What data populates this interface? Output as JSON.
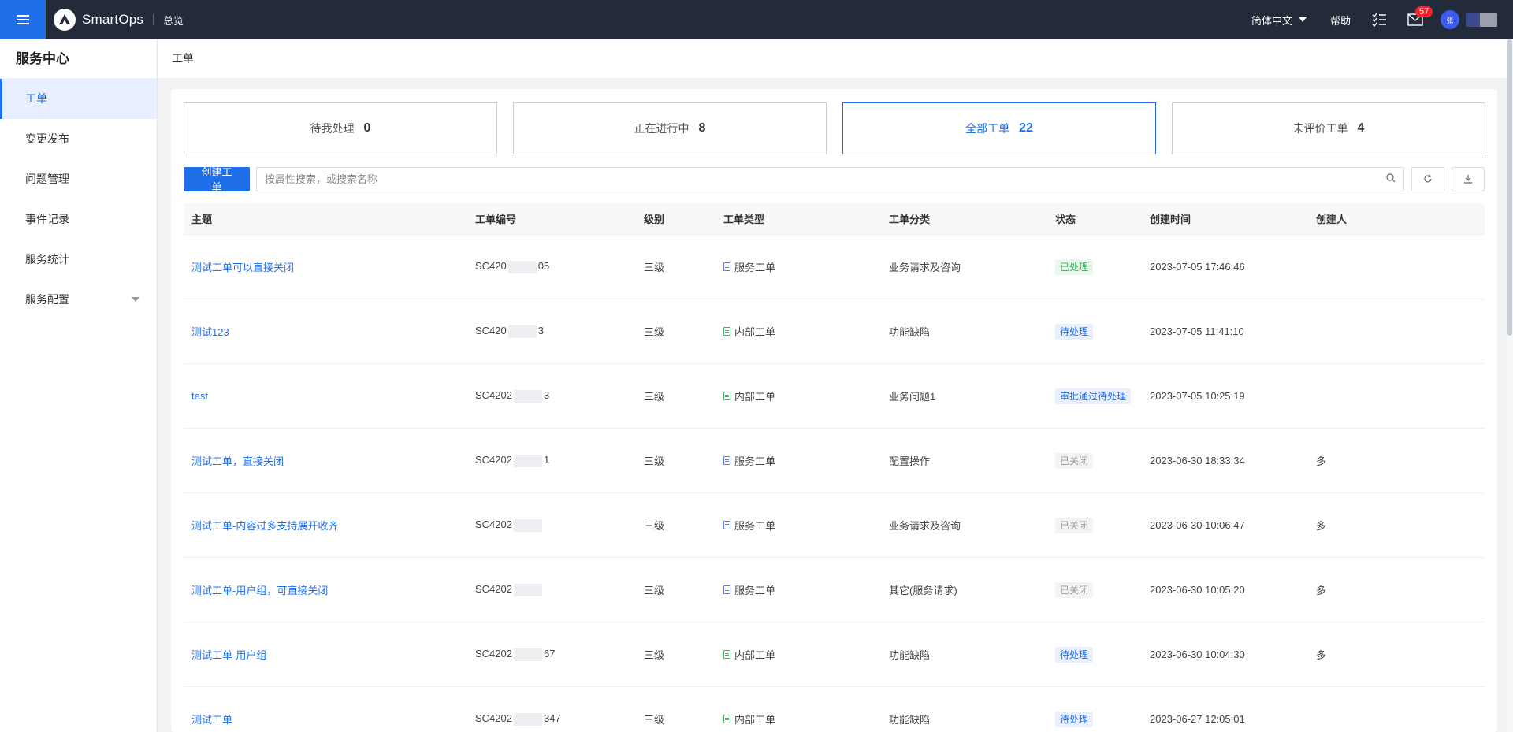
{
  "header": {
    "brand": "SmartOps",
    "overview": "总览",
    "language": "简体中文",
    "help": "帮助",
    "message_count": "57",
    "avatar_initial": "张"
  },
  "sidebar": {
    "title": "服务中心",
    "items": [
      {
        "label": "工单",
        "active": true
      },
      {
        "label": "变更发布"
      },
      {
        "label": "问题管理"
      },
      {
        "label": "事件记录"
      },
      {
        "label": "服务统计"
      },
      {
        "label": "服务配置"
      }
    ]
  },
  "breadcrumb": "工单",
  "cards": [
    {
      "label": "待我处理",
      "count": "0"
    },
    {
      "label": "正在进行中",
      "count": "8"
    },
    {
      "label": "全部工单",
      "count": "22"
    },
    {
      "label": "未评价工单",
      "count": "4"
    }
  ],
  "toolbar": {
    "create_label": "创建工单",
    "search_placeholder": "按属性搜索，或搜索名称"
  },
  "table": {
    "headers": [
      "主题",
      "工单编号",
      "级别",
      "工单类型",
      "工单分类",
      "状态",
      "创建时间",
      "创建人"
    ],
    "rows": [
      {
        "subject": "测试工单可以直接关闭",
        "id_prefix": "SC420",
        "id_suffix": "05",
        "level": "三级",
        "type": "服务工单",
        "category": "业务请求及咨询",
        "status": "已处理",
        "created": "2023-07-05 17:46:46",
        "creator": ""
      },
      {
        "subject": "测试123",
        "id_prefix": "SC420",
        "id_suffix": "3",
        "level": "三级",
        "type": "内部工单",
        "category": "功能缺陷",
        "status": "待处理",
        "created": "2023-07-05 11:41:10",
        "creator": ""
      },
      {
        "subject": "test",
        "id_prefix": "SC4202",
        "id_suffix": "3",
        "level": "三级",
        "type": "内部工单",
        "category": "业务问题1",
        "status": "审批通过待处理",
        "created": "2023-07-05 10:25:19",
        "creator": ""
      },
      {
        "subject": "测试工单，直接关闭",
        "id_prefix": "SC4202",
        "id_suffix": "1",
        "level": "三级",
        "type": "服务工单",
        "category": "配置操作",
        "status": "已关闭",
        "created": "2023-06-30 18:33:34",
        "creator": "多"
      },
      {
        "subject": "测试工单-内容过多支持展开收齐",
        "id_prefix": "SC4202",
        "id_suffix": "",
        "level": "三级",
        "type": "服务工单",
        "category": "业务请求及咨询",
        "status": "已关闭",
        "created": "2023-06-30 10:06:47",
        "creator": "多"
      },
      {
        "subject": "测试工单-用户组，可直接关闭",
        "id_prefix": "SC4202",
        "id_suffix": "",
        "level": "三级",
        "type": "服务工单",
        "category": "其它(服务请求)",
        "status": "已关闭",
        "created": "2023-06-30 10:05:20",
        "creator": "多"
      },
      {
        "subject": "测试工单-用户组",
        "id_prefix": "SC4202",
        "id_suffix": "67",
        "level": "三级",
        "type": "内部工单",
        "category": "功能缺陷",
        "status": "待处理",
        "created": "2023-06-30 10:04:30",
        "creator": "多"
      },
      {
        "subject": "测试工单",
        "id_prefix": "SC4202",
        "id_suffix": "347",
        "level": "三级",
        "type": "内部工单",
        "category": "功能缺陷",
        "status": "待处理",
        "created": "2023-06-27 12:05:01",
        "creator": ""
      }
    ]
  },
  "colors": {
    "accent": "#1f6feb",
    "topbar": "#232a3a",
    "done": "#2fb353",
    "closed": "#999999"
  }
}
